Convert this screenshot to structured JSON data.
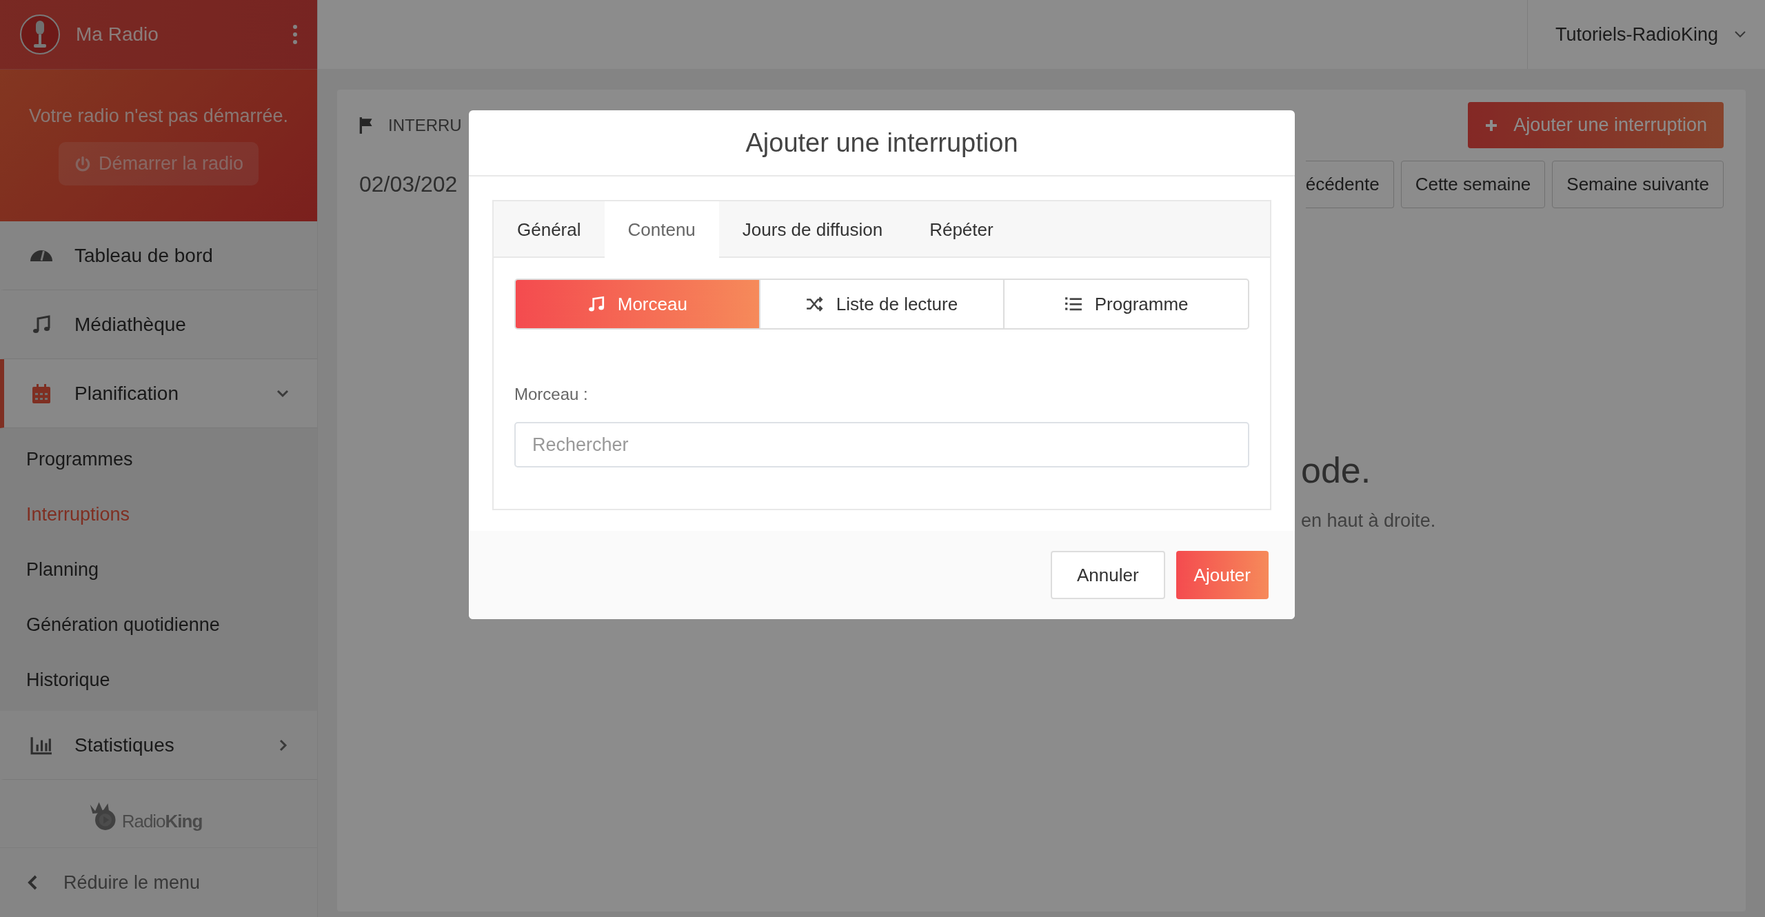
{
  "sidebar": {
    "station_name": "Ma Radio",
    "status_message": "Votre radio n'est pas démarrée.",
    "start_button": "Démarrer la radio",
    "start_disabled": true,
    "menu": [
      {
        "label": "Tableau de bord",
        "selected": false
      },
      {
        "label": "Médiathèque",
        "selected": false
      },
      {
        "label": "Planification",
        "selected": true,
        "expanded": true,
        "children": [
          {
            "label": "Programmes",
            "selected": false
          },
          {
            "label": "Interruptions",
            "selected": true
          },
          {
            "label": "Planning",
            "selected": false
          },
          {
            "label": "Génération quotidienne",
            "selected": false
          },
          {
            "label": "Historique",
            "selected": false
          }
        ]
      },
      {
        "label": "Statistiques",
        "selected": false,
        "expanded": false
      }
    ],
    "logo_text": "Radio**King**",
    "collapse": "Réduire le menu"
  },
  "topbar": {
    "account": "Tutoriels-RadioKing"
  },
  "page": {
    "section_title": "INTERRU",
    "add_button": "Ajouter une interruption",
    "date": "02/03/202",
    "week_buttons": [
      "écédente",
      "Cette semaine",
      "Semaine suivante"
    ],
    "empty_title": "ode.",
    "empty_hint": "en haut à droite."
  },
  "modal": {
    "title": "Ajouter une interruption",
    "tabs": [
      {
        "label": "Général",
        "selected": false
      },
      {
        "label": "Contenu",
        "selected": true
      },
      {
        "label": "Jours de diffusion",
        "selected": false
      },
      {
        "label": "Répéter",
        "selected": false
      }
    ],
    "content_types": [
      {
        "label": "Morceau",
        "selected": true
      },
      {
        "label": "Liste de lecture",
        "selected": false
      },
      {
        "label": "Programme",
        "selected": false
      }
    ],
    "field_label": "Morceau :",
    "search": {
      "placeholder": "Rechercher"
    },
    "buttons": [
      {
        "label": "Annuler",
        "kind": "secondary"
      },
      {
        "label": "Ajouter",
        "kind": "primary"
      }
    ]
  }
}
